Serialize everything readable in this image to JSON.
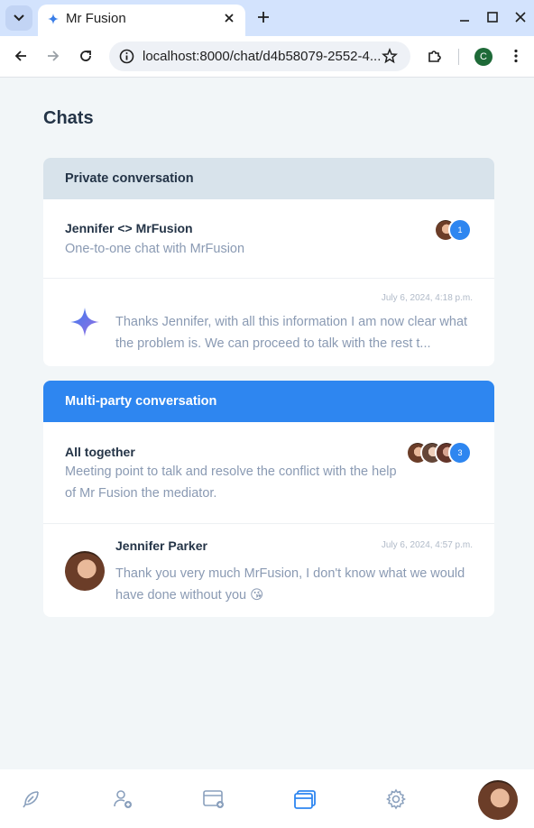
{
  "browser": {
    "tab_title": "Mr Fusion",
    "url": "localhost:8000/chat/d4b58079-2552-4...",
    "profile_initial": "C"
  },
  "page": {
    "title": "Chats"
  },
  "private_section": {
    "header": "Private conversation",
    "chat": {
      "title": "Jennifer <> MrFusion",
      "description": "One-to-one chat with MrFusion",
      "participant_count": "1"
    },
    "last_message": {
      "timestamp": "July 6, 2024, 4:18 p.m.",
      "text": "Thanks Jennifer, with all this information I am now clear what the problem is. We can proceed to talk with the rest t..."
    }
  },
  "multi_section": {
    "header": "Multi-party conversation",
    "chat": {
      "title": "All together",
      "description": "Meeting point to talk and resolve the conflict with the help of Mr Fusion the mediator.",
      "participant_count": "3"
    },
    "last_message": {
      "author": "Jennifer Parker",
      "timestamp": "July 6, 2024, 4:57 p.m.",
      "text": "Thank you very much MrFusion, I don't know what we would have done without you 😘"
    }
  },
  "bottom_nav": {
    "items": [
      "feather-icon",
      "add-user-icon",
      "new-chat-icon",
      "chats-icon",
      "settings-icon",
      "user-avatar"
    ]
  },
  "colors": {
    "accent": "#2e86f0",
    "header_grey": "#d8e3eb",
    "text_dark": "#243447",
    "text_muted": "#8a9ab3"
  }
}
